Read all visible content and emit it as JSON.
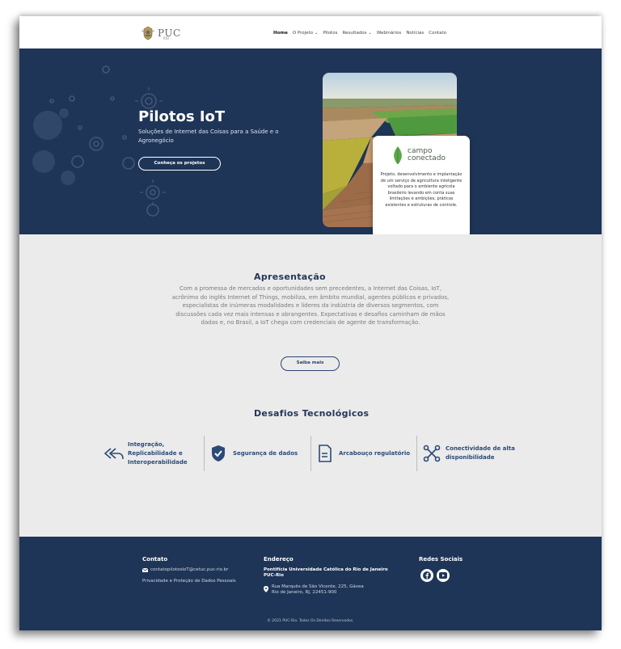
{
  "header": {
    "logo_text": "PUC",
    "logo_sub": "RIO",
    "nav": [
      "Home",
      "O Projeto ⌄",
      "Pilotos",
      "Resultados ⌄",
      "Webinários",
      "Notícias",
      "Contato"
    ]
  },
  "hero": {
    "title": "Pilotos IoT",
    "subtitle": "Soluções de Internet das Coisas para a Saúde e o Agronegócio",
    "button": "Conheça os projetos",
    "card": {
      "brand_line1": "campo",
      "brand_line2": "conectado",
      "text": "Projeto, desenvolvimento e implantação de um serviço de agricultura inteligente voltado para o ambiente agrícola brasileiro levando em conta suas limitações e ambições, práticas existentes e estruturas de controle."
    }
  },
  "apresentacao": {
    "title": "Apresentação",
    "text": "Com a promessa de mercados e oportunidades sem precedentes, a Internet das Coisas, IoT, acrônimo do inglês Internet of Things, mobiliza, em âmbito mundial, agentes públicos e privados, especialistas de inúmeras modalidades e líderes da indústria de diversos segmentos, com discussões cada vez mais intensas e abrangentes. Expectativas e desafios caminham de mãos dadas e, no Brasil, a IoT chega com credenciais de agente de transformação.",
    "button": "Saiba mais"
  },
  "desafios": {
    "title": "Desafios Tecnológicos",
    "items": [
      {
        "label": "Integração, Replicabilidade e Interoperabilidade",
        "icon": "reply-all-icon"
      },
      {
        "label": "Segurança de dados",
        "icon": "shield-check-icon"
      },
      {
        "label": "Arcabouço regulatório",
        "icon": "document-icon"
      },
      {
        "label": "Conectividade de alta disponibilidade",
        "icon": "network-icon"
      }
    ]
  },
  "footer": {
    "contato_title": "Contato",
    "email": "contatopilotosIoT@cetuc.puc-rio.br",
    "privacy": "Privacidade e Proteção de Dados Pessoais",
    "endereco_title": "Endereço",
    "org": "Pontifícia Universidade Católica do Rio de Janeiro PUC-Rio",
    "address_line1": "Rua Marquês de São Vicente, 225, Gávea",
    "address_line2": "Rio de Janeiro, RJ, 22451-900",
    "redes_title": "Redes Sociais",
    "copyright": "© 2021 PUC-Rio. Todos Os Direitos Reservados."
  },
  "colors": {
    "navy": "#1f3557",
    "accent_text": "#2b4a78",
    "gray_bg": "#ebebeb",
    "leaf_green": "#5aa84a"
  }
}
